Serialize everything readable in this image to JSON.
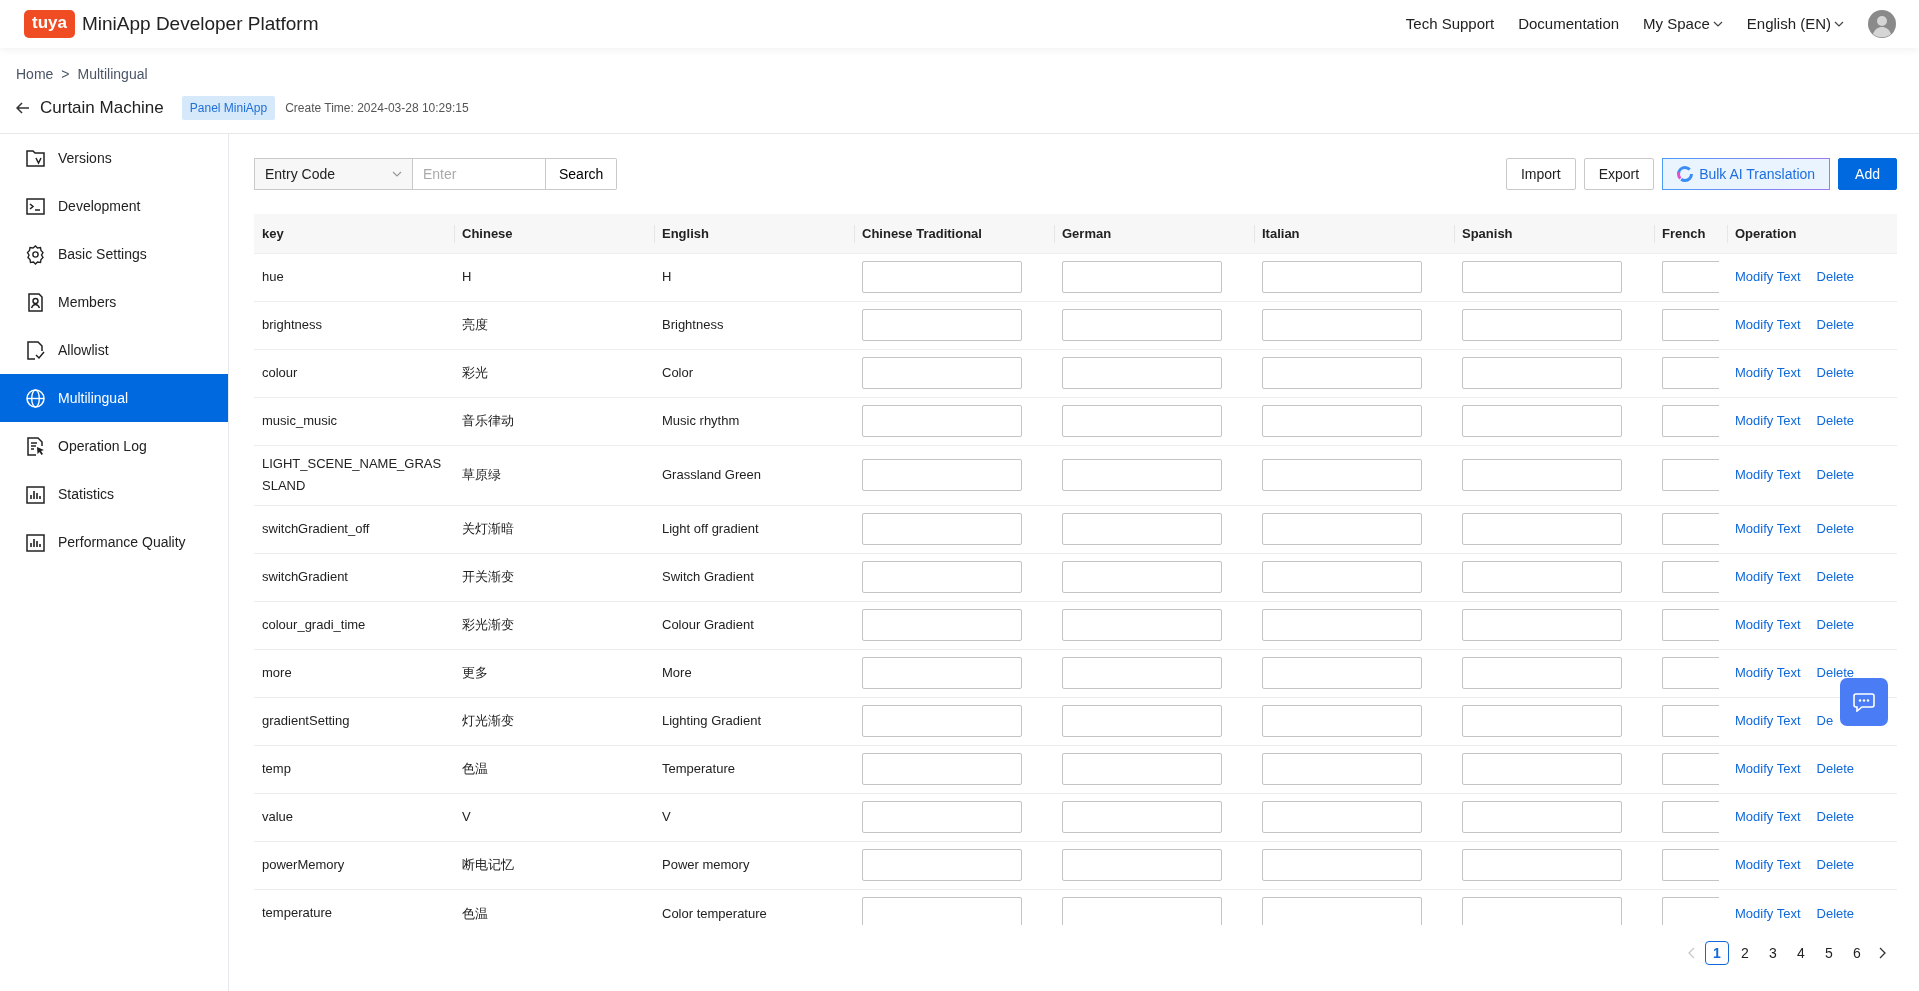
{
  "header": {
    "logo_text": "tuya",
    "title": "MiniApp Developer Platform",
    "nav": [
      {
        "label": "Tech Support",
        "dropdown": false
      },
      {
        "label": "Documentation",
        "dropdown": false
      },
      {
        "label": "My Space",
        "dropdown": true
      },
      {
        "label": "English (EN)",
        "dropdown": true
      }
    ]
  },
  "breadcrumb": {
    "items": [
      "Home",
      "Multilingual"
    ],
    "separator": ">"
  },
  "app": {
    "name": "Curtain Machine",
    "tag": "Panel MiniApp",
    "create_time": "Create Time: 2024-03-28 10:29:15"
  },
  "sidebar": {
    "items": [
      {
        "label": "Versions",
        "selected": false
      },
      {
        "label": "Development",
        "selected": false
      },
      {
        "label": "Basic Settings",
        "selected": false
      },
      {
        "label": "Members",
        "selected": false
      },
      {
        "label": "Allowlist",
        "selected": false
      },
      {
        "label": "Multilingual",
        "selected": true
      },
      {
        "label": "Operation Log",
        "selected": false
      },
      {
        "label": "Statistics",
        "selected": false
      },
      {
        "label": "Performance Quality",
        "selected": false
      }
    ]
  },
  "toolbar": {
    "filter": "Entry Code",
    "search_placeholder": "Enter",
    "search_button": "Search",
    "buttons": [
      {
        "label": "Import",
        "kind": "default"
      },
      {
        "label": "Export",
        "kind": "default"
      },
      {
        "label": "Bulk AI Translation",
        "kind": "ai"
      },
      {
        "label": "Add",
        "kind": "primary"
      }
    ]
  },
  "table": {
    "columns": [
      "key",
      "Chinese",
      "English",
      "Chinese Traditional",
      "German",
      "Italian",
      "Spanish",
      "French",
      "Operation"
    ],
    "rows": [
      {
        "key": "hue",
        "chinese": "H",
        "english": "H",
        "actions": [
          "Modify Text",
          "Delete"
        ]
      },
      {
        "key": "brightness",
        "chinese": "亮度",
        "english": "Brightness",
        "actions": [
          "Modify Text",
          "Delete"
        ]
      },
      {
        "key": "colour",
        "chinese": "彩光",
        "english": "Color",
        "actions": [
          "Modify Text",
          "Delete"
        ]
      },
      {
        "key": "music_music",
        "chinese": "音乐律动",
        "english": "Music rhythm",
        "actions": [
          "Modify Text",
          "Delete"
        ]
      },
      {
        "key": "LIGHT_SCENE_NAME_GRASSLAND",
        "chinese": "草原绿",
        "english": "Grassland Green",
        "actions": [
          "Modify Text",
          "Delete"
        ]
      },
      {
        "key": "switchGradient_off",
        "chinese": "关灯渐暗",
        "english": "Light off gradient",
        "actions": [
          "Modify Text",
          "Delete"
        ]
      },
      {
        "key": "switchGradient",
        "chinese": "开关渐变",
        "english": "Switch Gradient",
        "actions": [
          "Modify Text",
          "Delete"
        ]
      },
      {
        "key": "colour_gradi_time",
        "chinese": "彩光渐变",
        "english": "Colour Gradient",
        "actions": [
          "Modify Text",
          "Delete"
        ]
      },
      {
        "key": "more",
        "chinese": "更多",
        "english": "More",
        "actions": [
          "Modify Text",
          "Delete"
        ]
      },
      {
        "key": "gradientSetting",
        "chinese": "灯光渐变",
        "english": "Lighting Gradient",
        "actions": [
          "Modify Text",
          "De"
        ]
      },
      {
        "key": "temp",
        "chinese": "色温",
        "english": "Temperature",
        "actions": [
          "Modify Text",
          "Delete"
        ]
      },
      {
        "key": "value",
        "chinese": "V",
        "english": "V",
        "actions": [
          "Modify Text",
          "Delete"
        ]
      },
      {
        "key": "powerMemory",
        "chinese": "断电记忆",
        "english": "Power memory",
        "actions": [
          "Modify Text",
          "Delete"
        ]
      },
      {
        "key": "temperature",
        "chinese": "色温",
        "english": "Color temperature",
        "actions": [
          "Modify Text",
          "Delete"
        ]
      }
    ]
  },
  "pagination": {
    "prev_disabled": true,
    "next_disabled": false,
    "pages": [
      {
        "label": "1",
        "selected": true
      },
      {
        "label": "2",
        "selected": false
      },
      {
        "label": "3",
        "selected": false
      },
      {
        "label": "4",
        "selected": false
      },
      {
        "label": "5",
        "selected": false
      },
      {
        "label": "6",
        "selected": false
      }
    ]
  }
}
